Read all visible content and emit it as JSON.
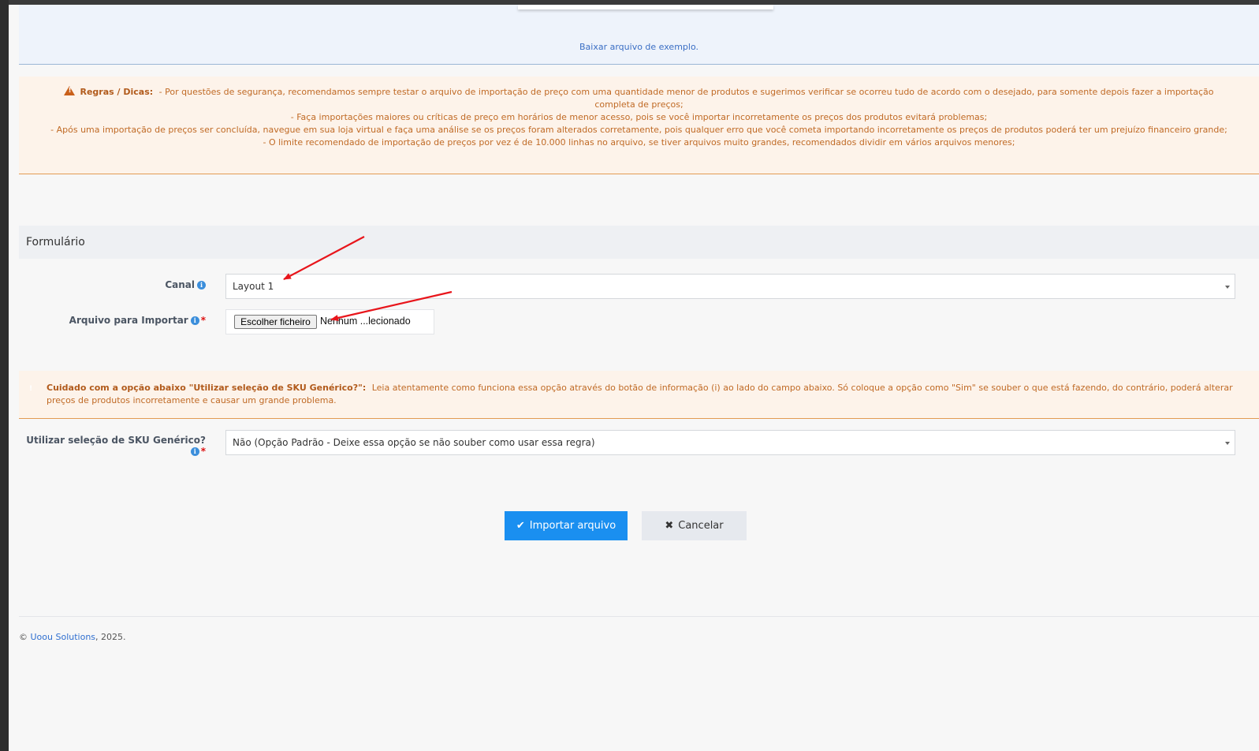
{
  "upload": {
    "sample_link": "Baixar arquivo de exemplo."
  },
  "rules": {
    "title": "Regras / Dicas:",
    "line1": "- Por questões de segurança, recomendamos sempre testar o arquivo de importação de preço com uma quantidade menor de produtos e sugerimos verificar se ocorreu tudo de acordo com o desejado, para somente depois fazer a importação completa de preços;",
    "line2": "- Faça importações maiores ou críticas de preço em horários de menor acesso, pois se você importar incorretamente os preços dos produtos evitará problemas;",
    "line3": "- Após uma importação de preços ser concluída, navegue em sua loja virtual e faça uma análise se os preços foram alterados corretamente, pois qualquer erro que você cometa importando incorretamente os preços de produtos poderá ter um prejuízo financeiro grande;",
    "line4": "- O limite recomendado de importação de preços por vez é de 10.000 linhas no arquivo, se tiver arquivos muito grandes, recomendados dividir em vários arquivos menores;"
  },
  "form": {
    "header": "Formulário",
    "canal_label": "Canal",
    "canal_value": "Layout 1",
    "file_label": "Arquivo para Importar",
    "file_button": "Escolher ficheiro",
    "file_status": "Nenhum ...lecionado",
    "required_mark": "*",
    "info_glyph": "i"
  },
  "caution": {
    "title": "Cuidado com a opção abaixo \"Utilizar seleção de SKU Genérico?\":",
    "text": "Leia atentamente como funciona essa opção através do botão de informação (i) ao lado do campo abaixo. Só coloque a opção como \"Sim\" se souber o que está fazendo, do contrário, poderá alterar preços de produtos incorretamente e causar um grande problema."
  },
  "sku": {
    "label": "Utilizar seleção de SKU Genérico?",
    "value": "Não (Opção Padrão - Deixe essa opção se não souber como usar essa regra)"
  },
  "actions": {
    "import_label": "Importar arquivo",
    "import_icon": "✔",
    "cancel_label": "Cancelar",
    "cancel_icon": "✖"
  },
  "footer": {
    "prefix": "© ",
    "company": "Uoou Solutions",
    "suffix": ", 2025."
  },
  "colors": {
    "primary": "#1a8ff0",
    "warning_text": "#c06a25",
    "warning_bg": "#fdf3ea",
    "annotation_arrow": "#e8151b"
  },
  "icons": {
    "warning": "warning-triangle-icon",
    "info": "info-circle-icon",
    "check": "check-icon",
    "times": "times-icon"
  }
}
